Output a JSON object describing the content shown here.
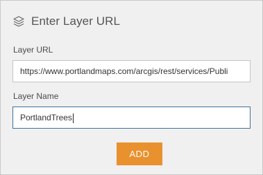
{
  "header": {
    "title": "Enter Layer URL",
    "icon": "layers-icon"
  },
  "form": {
    "layer_url": {
      "label": "Layer URL",
      "value": "https://www.portlandmaps.com/arcgis/rest/services/Publi"
    },
    "layer_name": {
      "label": "Layer Name",
      "value": "PortlandTrees"
    },
    "add_button_label": "ADD"
  },
  "colors": {
    "button": "#e8912e",
    "focused_border": "#3e6f9a",
    "panel_background": "#f0f0f0"
  }
}
